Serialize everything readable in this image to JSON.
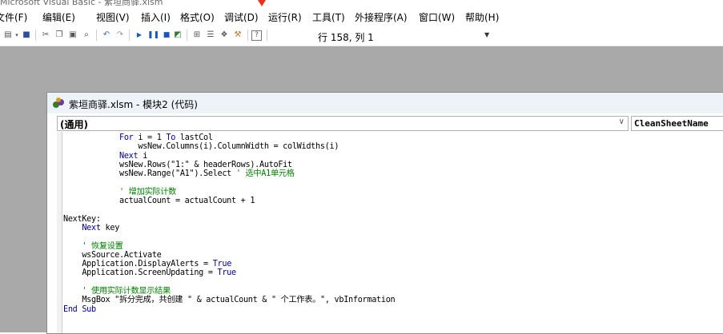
{
  "window": {
    "partial_title": "Microsoft Visual Basic - 紫垣商驿.xlsm"
  },
  "menubar": {
    "items": [
      {
        "label": "文件(F)"
      },
      {
        "label": "编辑(E)"
      },
      {
        "label": "视图(V)"
      },
      {
        "label": "插入(I)"
      },
      {
        "label": "格式(O)"
      },
      {
        "label": "调试(D)"
      },
      {
        "label": "运行(R)"
      },
      {
        "label": "工具(T)"
      },
      {
        "label": "外接程序(A)"
      },
      {
        "label": "窗口(W)"
      },
      {
        "label": "帮助(H)"
      }
    ]
  },
  "toolbar": {
    "cursor_position": "行 158, 列 1",
    "icons": [
      "insert-module-icon",
      "save-icon",
      "cut-icon",
      "copy-icon",
      "paste-icon",
      "find-icon",
      "undo-icon",
      "redo-icon",
      "run-icon",
      "break-icon",
      "reset-icon",
      "design-mode-icon",
      "project-explorer-icon",
      "properties-window-icon",
      "object-browser-icon",
      "toolbox-icon",
      "help-icon"
    ]
  },
  "code_window": {
    "title": "紫垣商驿.xlsm - 模块2 (代码)",
    "object_combo": "(通用)",
    "procedure_combo": "CleanSheetName",
    "lines": [
      {
        "indent": "            ",
        "parts": [
          {
            "t": "For",
            "c": "kw"
          },
          {
            "t": " i = 1 ",
            "c": ""
          },
          {
            "t": "To",
            "c": "kw"
          },
          {
            "t": " lastCol",
            "c": ""
          }
        ]
      },
      {
        "indent": "                ",
        "parts": [
          {
            "t": "wsNew.Columns(i).ColumnWidth = colWidths(i)",
            "c": ""
          }
        ]
      },
      {
        "indent": "            ",
        "parts": [
          {
            "t": "Next",
            "c": "kw"
          },
          {
            "t": " i",
            "c": ""
          }
        ]
      },
      {
        "indent": "            ",
        "parts": [
          {
            "t": "wsNew.Rows(\"1:\" & headerRows).AutoFit",
            "c": ""
          }
        ]
      },
      {
        "indent": "            ",
        "parts": [
          {
            "t": "wsNew.Range(\"A1\").Select ",
            "c": ""
          },
          {
            "t": "' 选中A1单元格",
            "c": "cm"
          }
        ]
      },
      {
        "indent": "",
        "parts": []
      },
      {
        "indent": "            ",
        "parts": [
          {
            "t": "' 增加实际计数",
            "c": "cm"
          }
        ]
      },
      {
        "indent": "            ",
        "parts": [
          {
            "t": "actualCount = actualCount + 1",
            "c": ""
          }
        ]
      },
      {
        "indent": "",
        "parts": []
      },
      {
        "indent": "",
        "parts": [
          {
            "t": "NextKey:",
            "c": ""
          }
        ]
      },
      {
        "indent": "    ",
        "parts": [
          {
            "t": "Next",
            "c": "kw"
          },
          {
            "t": " key",
            "c": ""
          }
        ]
      },
      {
        "indent": "",
        "parts": []
      },
      {
        "indent": "    ",
        "parts": [
          {
            "t": "' 恢复设置",
            "c": "cm"
          }
        ]
      },
      {
        "indent": "    ",
        "parts": [
          {
            "t": "wsSource.Activate",
            "c": ""
          }
        ]
      },
      {
        "indent": "    ",
        "parts": [
          {
            "t": "Application.DisplayAlerts = ",
            "c": ""
          },
          {
            "t": "True",
            "c": "kw"
          }
        ]
      },
      {
        "indent": "    ",
        "parts": [
          {
            "t": "Application.ScreenUpdating = ",
            "c": ""
          },
          {
            "t": "True",
            "c": "kw"
          }
        ]
      },
      {
        "indent": "",
        "parts": []
      },
      {
        "indent": "    ",
        "parts": [
          {
            "t": "' 使用实际计数显示结果",
            "c": "cm"
          }
        ]
      },
      {
        "indent": "    ",
        "parts": [
          {
            "t": "MsgBox \"拆分完成，共创建 \" & actualCount & \" 个工作表。\", vbInformation",
            "c": ""
          }
        ]
      },
      {
        "indent": "",
        "parts": [
          {
            "t": "End Sub",
            "c": "kw"
          }
        ]
      }
    ]
  }
}
